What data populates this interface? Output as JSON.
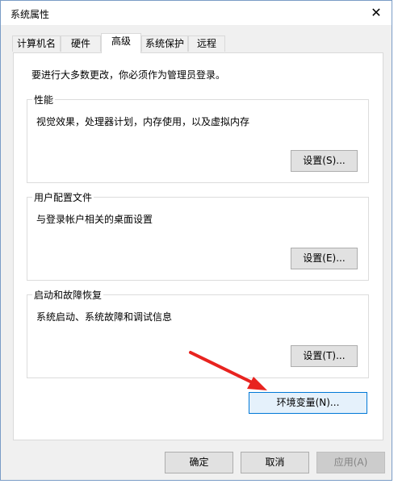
{
  "window": {
    "title": "系统属性"
  },
  "tabs": [
    {
      "label": "计算机名"
    },
    {
      "label": "硬件"
    },
    {
      "label": "高级"
    },
    {
      "label": "系统保护"
    },
    {
      "label": "远程"
    }
  ],
  "advanced": {
    "notice": "要进行大多数更改，你必须作为管理员登录。",
    "performance": {
      "title": "性能",
      "desc": "视觉效果，处理器计划，内存使用，以及虚拟内存",
      "button": "设置(S)..."
    },
    "user_profiles": {
      "title": "用户配置文件",
      "desc": "与登录帐户相关的桌面设置",
      "button": "设置(E)..."
    },
    "startup_recovery": {
      "title": "启动和故障恢复",
      "desc": "系统启动、系统故障和调试信息",
      "button": "设置(T)..."
    },
    "env_button": "环境变量(N)..."
  },
  "footer": {
    "ok": "确定",
    "cancel": "取消",
    "apply": "应用(A)"
  },
  "colors": {
    "accent": "#0078d7",
    "arrow": "#e8231f"
  }
}
